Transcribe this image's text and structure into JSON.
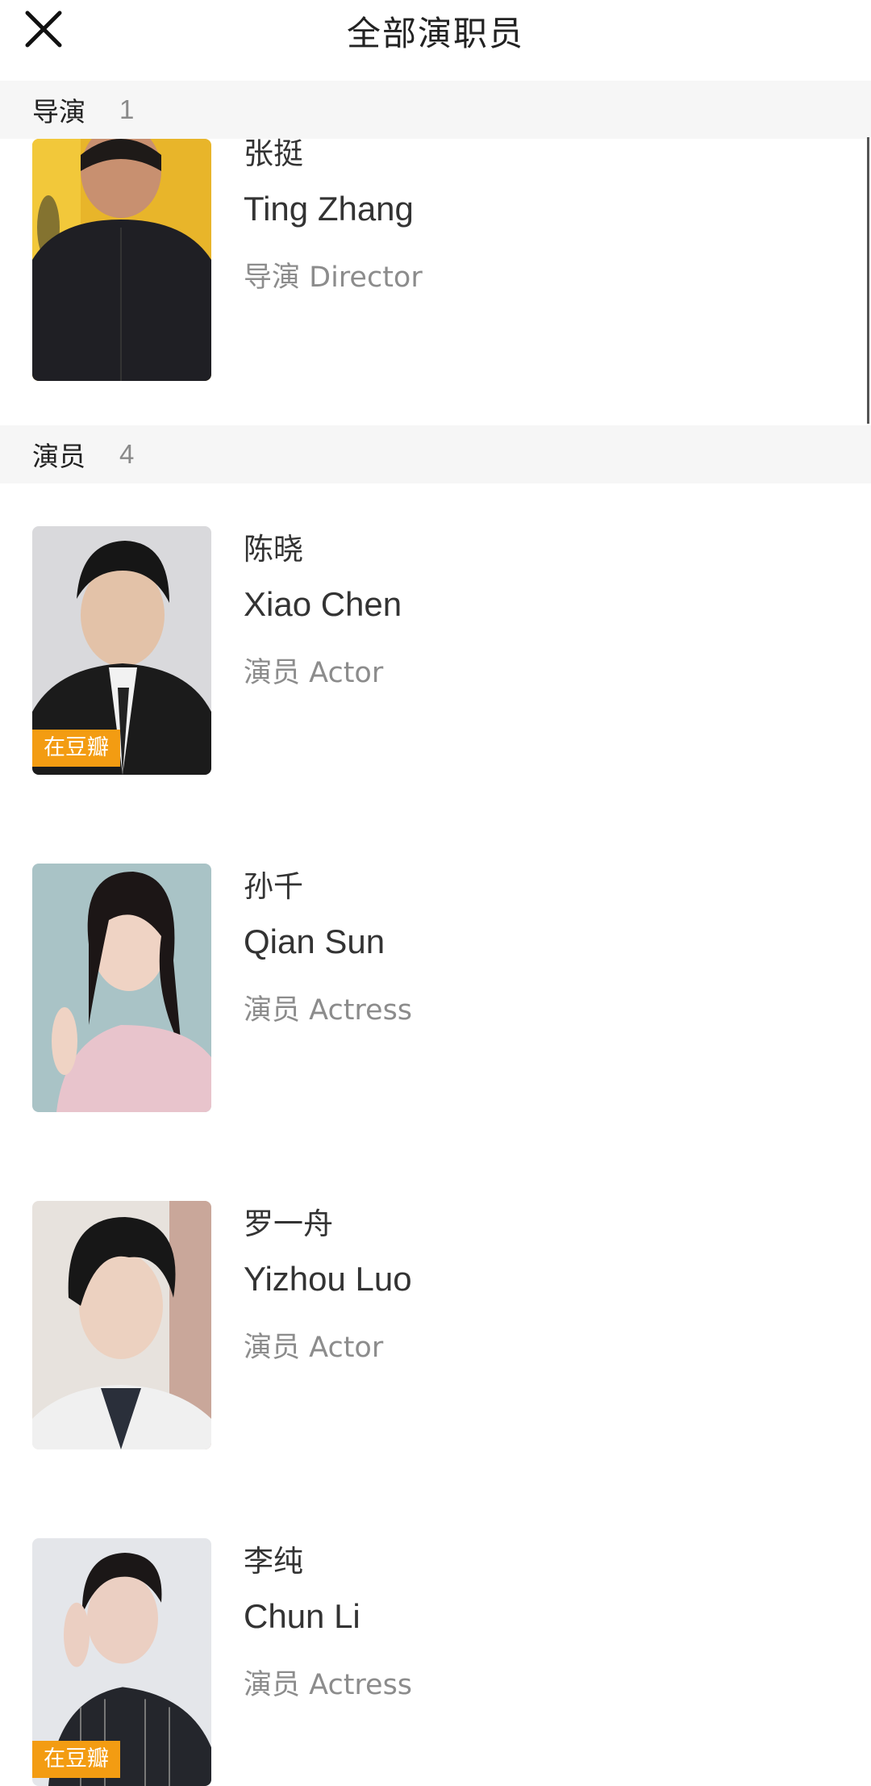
{
  "header": {
    "title": "全部演职员",
    "close_icon": "close-icon"
  },
  "sections": [
    {
      "label": "导演",
      "count": "1"
    },
    {
      "label": "演员",
      "count": "4"
    }
  ],
  "people": [
    {
      "name_cn": "张挺",
      "name_en": "Ting Zhang",
      "role": "导演 Director",
      "badge": ""
    },
    {
      "name_cn": "陈晓",
      "name_en": "Xiao Chen",
      "role": "演员 Actor",
      "badge": "在豆瓣"
    },
    {
      "name_cn": "孙千",
      "name_en": "Qian Sun",
      "role": "演员 Actress",
      "badge": ""
    },
    {
      "name_cn": "罗一舟",
      "name_en": "Yizhou Luo",
      "role": "演员 Actor",
      "badge": ""
    },
    {
      "name_cn": "李纯",
      "name_en": "Chun Li",
      "role": "演员 Actress",
      "badge": "在豆瓣"
    }
  ],
  "colors": {
    "badge": "#f39c12",
    "section_bg": "#f6f6f6",
    "secondary_text": "#8c8c8c"
  }
}
